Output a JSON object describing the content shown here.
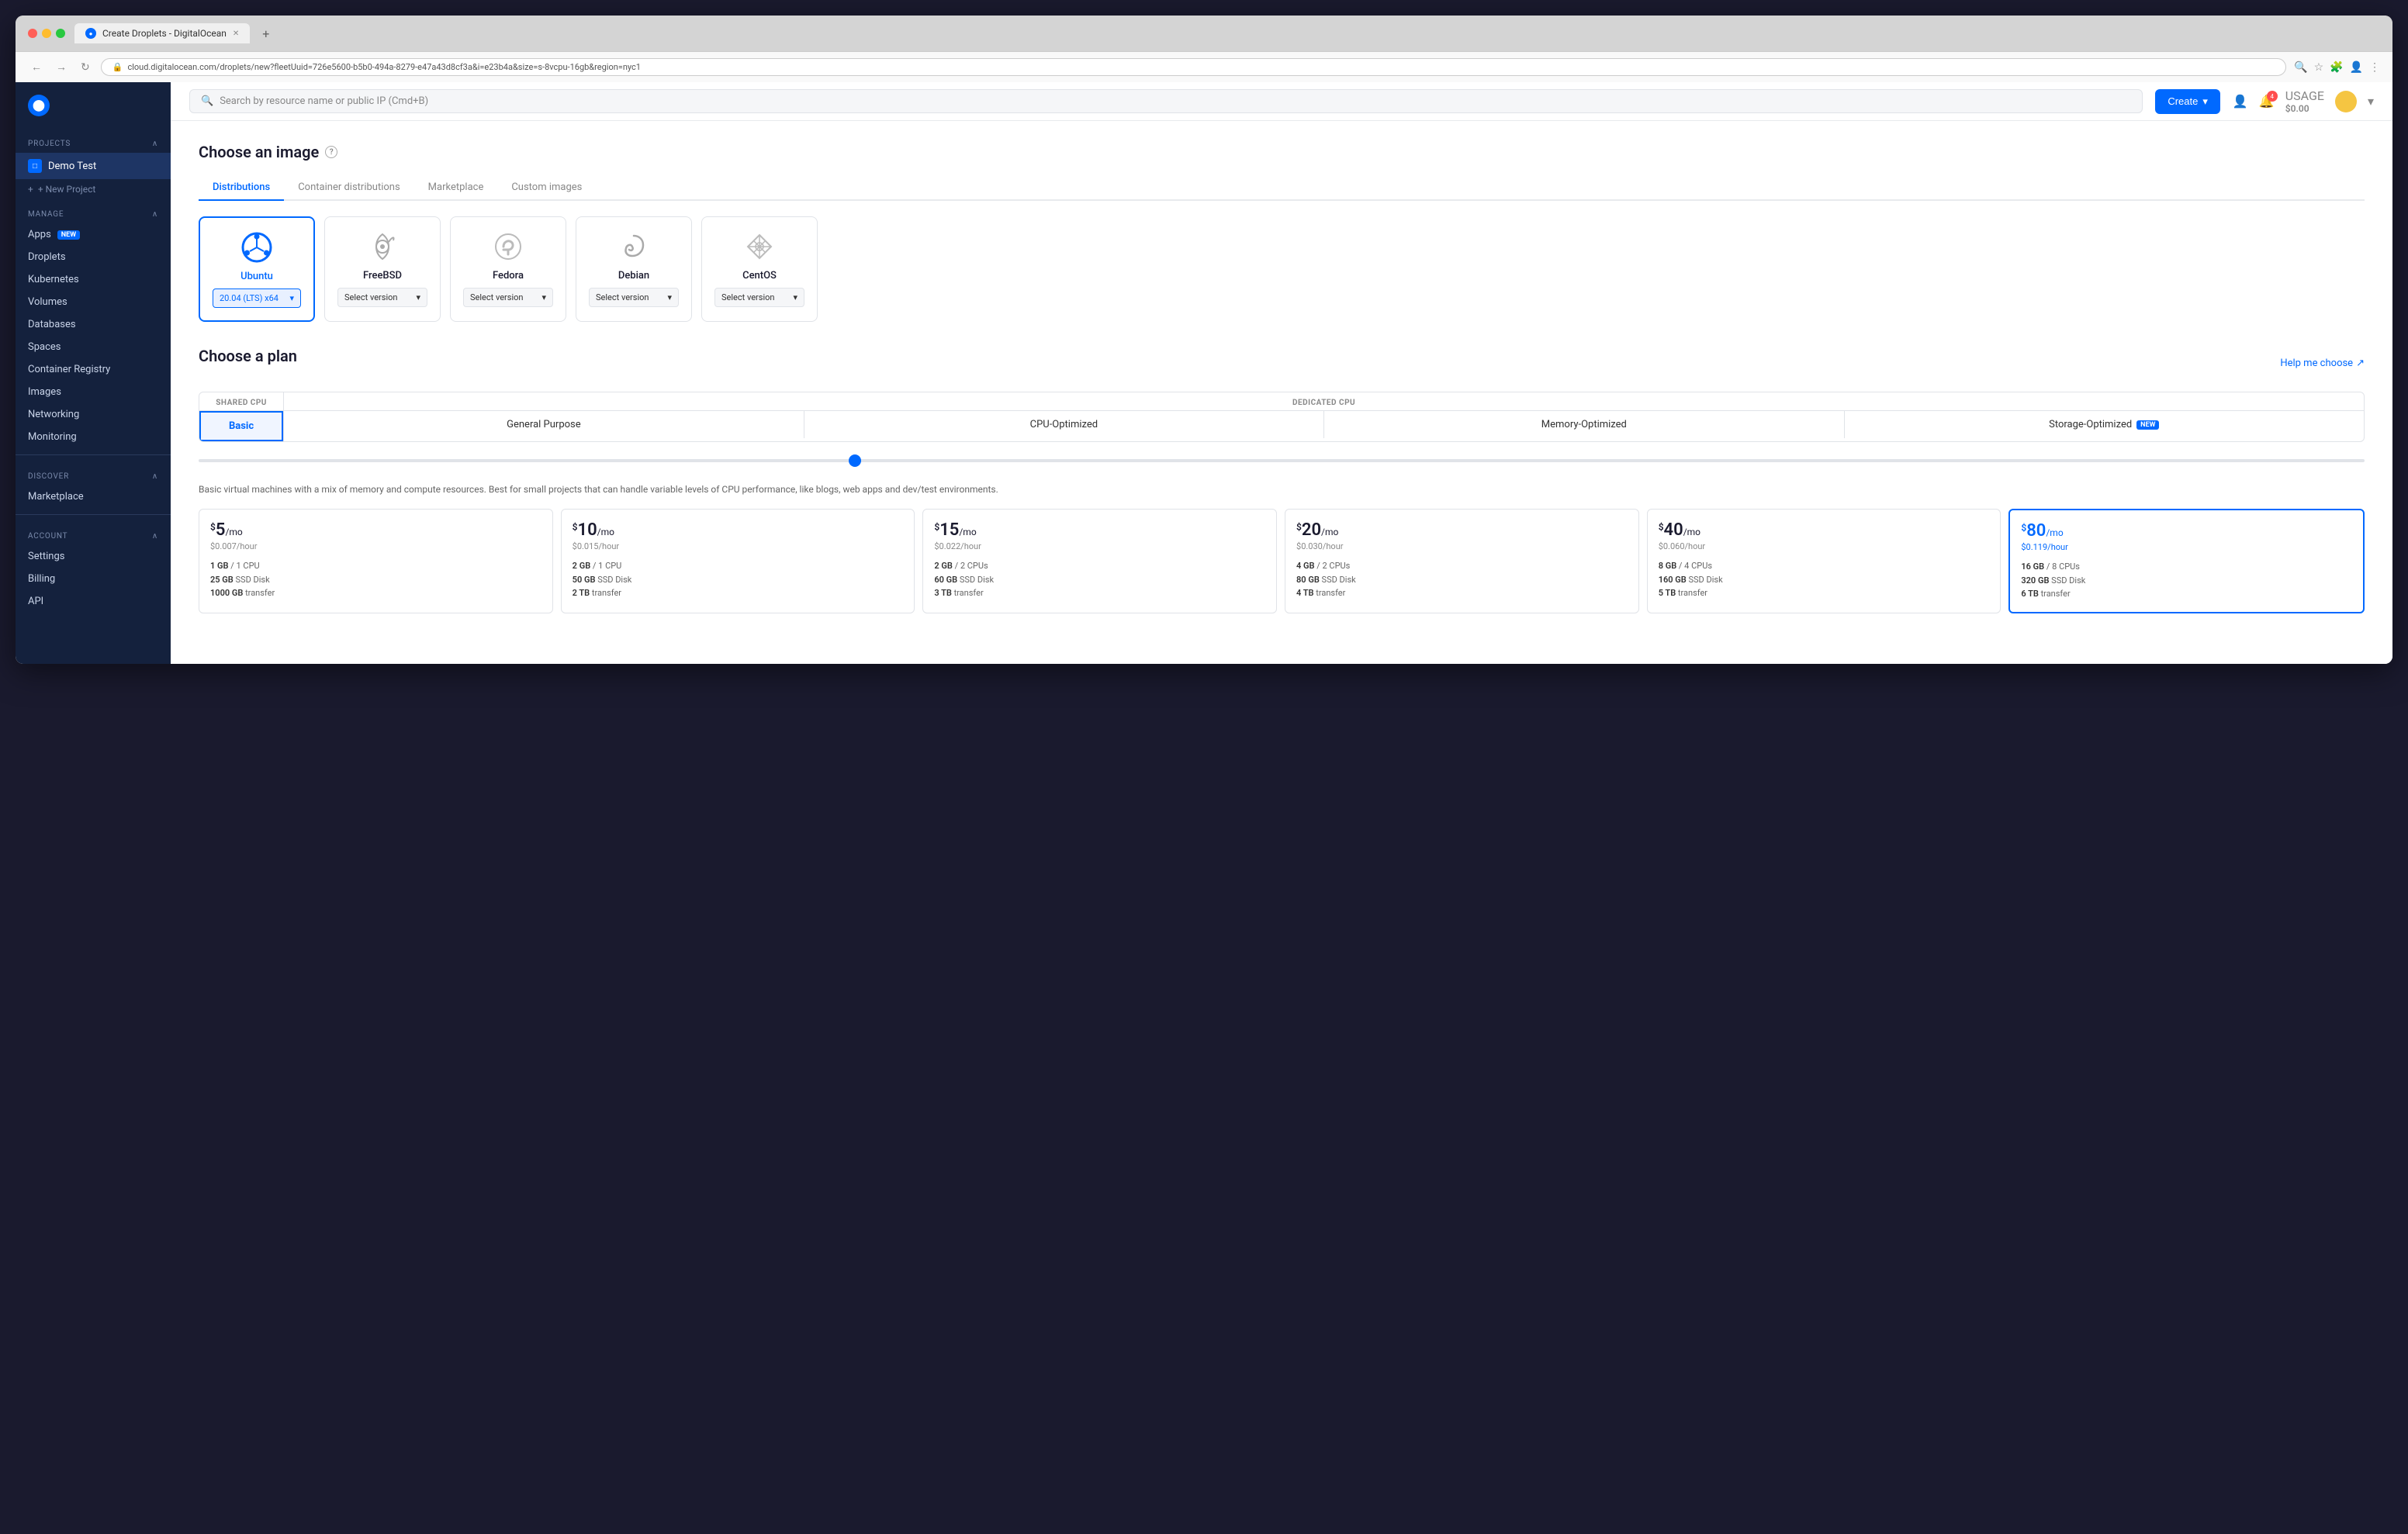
{
  "browser": {
    "tab_title": "Create Droplets - DigitalOcean",
    "url": "cloud.digitalocean.com/droplets/new?fleetUuid=726e5600-b5b0-494a-8279-e47a43d8cf3a&i=e23b4a&size=s-8vcpu-16gb&region=nyc1",
    "new_tab_icon": "+",
    "nav_back": "←",
    "nav_forward": "→",
    "nav_refresh": "↻"
  },
  "topbar": {
    "search_placeholder": "Search by resource name or public IP (Cmd+B)",
    "create_label": "Create",
    "usage_label": "USAGE",
    "usage_value": "$0.00",
    "notification_count": "4"
  },
  "sidebar": {
    "projects_label": "PROJECTS",
    "active_project": "Demo Test",
    "new_project_label": "+ New Project",
    "manage_label": "MANAGE",
    "manage_items": [
      {
        "key": "apps",
        "label": "Apps",
        "badge": "NEW"
      },
      {
        "key": "droplets",
        "label": "Droplets"
      },
      {
        "key": "kubernetes",
        "label": "Kubernetes"
      },
      {
        "key": "volumes",
        "label": "Volumes"
      },
      {
        "key": "databases",
        "label": "Databases"
      },
      {
        "key": "spaces",
        "label": "Spaces"
      },
      {
        "key": "container-registry",
        "label": "Container Registry"
      },
      {
        "key": "images",
        "label": "Images"
      },
      {
        "key": "networking",
        "label": "Networking"
      },
      {
        "key": "monitoring",
        "label": "Monitoring"
      }
    ],
    "discover_label": "DISCOVER",
    "discover_items": [
      {
        "key": "marketplace",
        "label": "Marketplace"
      }
    ],
    "account_label": "ACCOUNT",
    "account_items": [
      {
        "key": "settings",
        "label": "Settings"
      },
      {
        "key": "billing",
        "label": "Billing"
      },
      {
        "key": "api",
        "label": "API"
      }
    ]
  },
  "main": {
    "choose_image_title": "Choose an image",
    "help_icon": "?",
    "image_tabs": [
      {
        "key": "distributions",
        "label": "Distributions",
        "active": true
      },
      {
        "key": "container-distributions",
        "label": "Container distributions"
      },
      {
        "key": "marketplace",
        "label": "Marketplace"
      },
      {
        "key": "custom-images",
        "label": "Custom images"
      }
    ],
    "distros": [
      {
        "key": "ubuntu",
        "name": "Ubuntu",
        "icon": "🐧",
        "version": "20.04 (LTS) x64",
        "selected": true,
        "icon_color": "#0069ff"
      },
      {
        "key": "freebsd",
        "name": "FreeBSD",
        "icon": "😈",
        "version": "Select version",
        "selected": false
      },
      {
        "key": "fedora",
        "name": "Fedora",
        "icon": "🎩",
        "version": "Select version",
        "selected": false
      },
      {
        "key": "debian",
        "name": "Debian",
        "icon": "🌀",
        "version": "Select version",
        "selected": false
      },
      {
        "key": "centos",
        "name": "CentOS",
        "icon": "⚙️",
        "version": "Select version",
        "selected": false
      }
    ],
    "choose_plan_title": "Choose a plan",
    "help_me_choose": "Help me choose",
    "plan_shared_cpu_label": "SHARED CPU",
    "plan_dedicated_cpu_label": "DEDICATED CPU",
    "plan_tabs": [
      {
        "key": "basic",
        "label": "Basic",
        "active": true
      },
      {
        "key": "general-purpose",
        "label": "General Purpose"
      },
      {
        "key": "cpu-optimized",
        "label": "CPU-Optimized"
      },
      {
        "key": "memory-optimized",
        "label": "Memory-Optimized"
      },
      {
        "key": "storage-optimized",
        "label": "Storage-Optimized",
        "badge": "NEW"
      }
    ],
    "plan_description": "Basic virtual machines with a mix of memory and compute resources. Best for small projects that can handle variable levels of CPU performance, like blogs, web apps and dev/test environments.",
    "pricing_cards": [
      {
        "key": "plan-5",
        "dollar": "$",
        "amount": "5",
        "per": "/mo",
        "hour": "$0.007/hour",
        "specs": [
          "1 GB / 1 CPU",
          "25 GB SSD Disk",
          "1000 GB transfer"
        ],
        "selected": false
      },
      {
        "key": "plan-10",
        "dollar": "$",
        "amount": "10",
        "per": "/mo",
        "hour": "$0.015/hour",
        "specs": [
          "2 GB / 1 CPU",
          "50 GB SSD Disk",
          "2 TB transfer"
        ],
        "selected": false
      },
      {
        "key": "plan-15",
        "dollar": "$",
        "amount": "15",
        "per": "/mo",
        "hour": "$0.022/hour",
        "specs": [
          "2 GB / 2 CPUs",
          "60 GB SSD Disk",
          "3 TB transfer"
        ],
        "selected": false
      },
      {
        "key": "plan-20",
        "dollar": "$",
        "amount": "20",
        "per": "/mo",
        "hour": "$0.030/hour",
        "specs": [
          "4 GB / 2 CPUs",
          "80 GB SSD Disk",
          "4 TB transfer"
        ],
        "selected": false
      },
      {
        "key": "plan-40",
        "dollar": "$",
        "amount": "40",
        "per": "/mo",
        "hour": "$0.060/hour",
        "specs": [
          "8 GB / 4 CPUs",
          "160 GB SSD Disk",
          "5 TB transfer"
        ],
        "selected": false
      },
      {
        "key": "plan-80",
        "dollar": "$",
        "amount": "80",
        "per": "/mo",
        "hour": "$0.119/hour",
        "specs": [
          "16 GB / 8 CPUs",
          "320 GB SSD Disk",
          "6 TB transfer"
        ],
        "selected": true
      }
    ]
  }
}
